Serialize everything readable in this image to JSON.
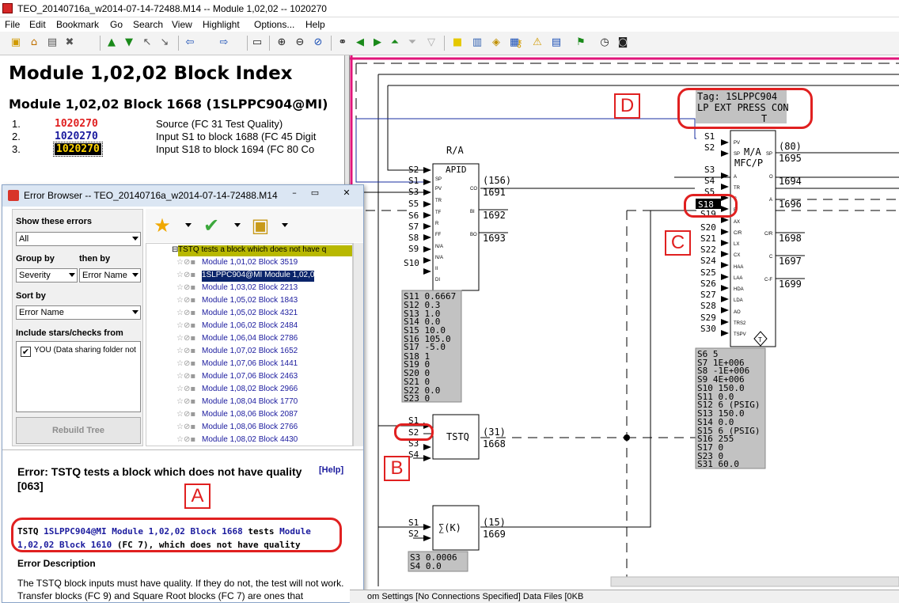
{
  "window": {
    "title": "TEO_20140716a_w2014-07-14-72488.M14 -- Module 1,02,02 -- 1020270"
  },
  "menu": [
    "File",
    "Edit",
    "Bookmark",
    "Go",
    "Search",
    "View",
    "Highlight",
    "Options...",
    "Help"
  ],
  "toolbar_icons": [
    "save-icon",
    "home-icon",
    "print-icon",
    "close-icon",
    "up-icon",
    "down-icon",
    "expand-icon",
    "collapse-icon",
    "back-icon",
    "forward-icon",
    "window-icon",
    "zoom-in-icon",
    "zoom-out-icon",
    "zoom-fit-icon",
    "binoculars-icon",
    "prev-icon",
    "next-icon",
    "find-prev-icon",
    "find-next-icon",
    "highlight-icon",
    "bookmark-icon",
    "tag-icon",
    "database-icon",
    "key-icon",
    "warning-icon",
    "list-icon",
    "flag-icon",
    "goto-icon",
    "clock-icon",
    "camera-icon"
  ],
  "index": {
    "title": "Module 1,02,02 Block Index",
    "block_title": "Module 1,02,02 Block 1668 (1SLPPC904@MI)",
    "rows": [
      {
        "num": "1.",
        "value": "1020270",
        "desc": "Source (FC 31 Test Quality)"
      },
      {
        "num": "2.",
        "value": "1020270",
        "desc": "Input S1 to block 1688 (FC 45 Digit"
      },
      {
        "num": "3.",
        "value": "1020270",
        "desc": "Input S18 to block 1694 (FC 80 Co"
      }
    ]
  },
  "error_browser": {
    "title": "Error Browser -- TEO_20140716a_w2014-07-14-72488.M14",
    "show_label": "Show these errors",
    "show_value": "All",
    "group_label": "Group by",
    "then_label": "then by",
    "group_value": "Severity",
    "then_value": "Error Name",
    "sort_label": "Sort by",
    "sort_value": "Error Name",
    "include_label": "Include stars/checks from",
    "include_item": "YOU (Data sharing folder not",
    "include_check": "✔",
    "rebuild_label": "Rebuild Tree",
    "toolbar_icons": [
      "star-icon",
      "checkmark-icon",
      "add-folder-icon"
    ],
    "tree_header": "TSTQ tests a block which does not have q",
    "tree_items": [
      "Module 1,01,02 Block 3519",
      "1SLPPC904@MI Module 1,02,0",
      "Module 1,03,02 Block 2213",
      "Module 1,05,02 Block 1843",
      "Module 1,05,02 Block 4321",
      "Module 1,06,02 Block 2484",
      "Module 1,06,04 Block 2786",
      "Module 1,07,02 Block 1652",
      "Module 1,07,06 Block 1441",
      "Module 1,07,06 Block 2463",
      "Module 1,08,02 Block 2966",
      "Module 1,08,04 Block 1770",
      "Module 1,08,06 Block 2087",
      "Module 1,08,06 Block 2766",
      "Module 1,08,02 Block 4430"
    ],
    "error_heading": "Error: TSTQ tests a block which does not have quality",
    "help": "[Help]",
    "error_code": "[063]",
    "msg_a": "TSTQ ",
    "msg_b": "1SLPPC904@MI Module 1,02,02 Block 1668",
    "msg_c": " tests ",
    "msg_d": "Module 1,02,02 Block 1610",
    "msg_e": " (FC 7), which does not have quality",
    "desc_head": "Error Description",
    "desc_text": "The TSTQ block inputs must have quality. If they do not, the test will not work. Transfer blocks (FC 9) and Square Root blocks (FC 7) are ones that"
  },
  "callout_labels": {
    "a": "A",
    "b": "B",
    "c": "C",
    "d": "D"
  },
  "diagram": {
    "ra_title": "R/A",
    "apid_name": "APID",
    "apid_inputs": [
      "S2",
      "S1",
      "S3",
      "S5",
      "S6",
      "S7",
      "S8",
      "S9",
      "S10"
    ],
    "apid_pins": [
      "SP",
      "PV",
      "TR",
      "TF",
      "R",
      "FF",
      "N/A",
      "N/A",
      "II",
      "DI"
    ],
    "apid_out_pins": [
      "CO",
      "BI",
      "BO"
    ],
    "apid_outputs": [
      {
        "n": "(156)",
        "b": "1691"
      },
      {
        "n": "",
        "b": "1692"
      },
      {
        "n": "",
        "b": "1693"
      }
    ],
    "apid_params": [
      "S11 0.6667",
      "S12 0.3",
      "S13 1.0",
      "S14 0.0",
      "S15 10.0",
      "S16 105.0",
      "S17 -5.0",
      "S18 1",
      "S19 0",
      "S20 0",
      "S21 0",
      "S22 0.0",
      "S23 0"
    ],
    "tstq_name": "TSTQ",
    "tstq_inputs": [
      "S1",
      "S2",
      "S3",
      "S4"
    ],
    "tstq_out": "(31)",
    "tstq_block": "1668",
    "sum_name": "∑(K)",
    "sum_inputs": [
      "S1",
      "S2"
    ],
    "sum_out": "(15)",
    "sum_block": "1669",
    "sum_params": [
      "S3  0.0006",
      "S4  0.0"
    ],
    "tag_line1": "Tag: 1SLPPC904",
    "tag_line2": "LP EXT PRESS CON",
    "tag_line3": "T",
    "mfc_name1": "M/A",
    "mfc_name2": "MFC/P",
    "mfc_inputs": [
      "S1",
      "S2",
      "S3",
      "S4",
      "S5",
      "S18",
      "S19",
      "S20",
      "S21",
      "S22",
      "S24",
      "S25",
      "S26",
      "S27",
      "S28",
      "S29",
      "S30"
    ],
    "mfc_in_pins": [
      "PV",
      "SP",
      "A",
      "TR",
      "S",
      "E",
      "AX",
      "C/R",
      "LX",
      "CX",
      "HAA",
      "LAA",
      "HDA",
      "LDA",
      "AO",
      "TRS2",
      "TSPV"
    ],
    "mfc_out_pins": [
      "SP",
      "O",
      "A",
      "C/R",
      "C",
      "C-F"
    ],
    "mfc_outputs": [
      {
        "n": "(80)",
        "b": "1695"
      },
      {
        "n": "",
        "b": "1694"
      },
      {
        "n": "",
        "b": "1696"
      },
      {
        "n": "",
        "b": "1698"
      },
      {
        "n": "",
        "b": "1697"
      },
      {
        "n": "",
        "b": "1699"
      }
    ],
    "mfc_params": [
      "S6  5",
      "S7  1E+006",
      "S8  -1E+006",
      "S9  4E+006",
      "S10 150.0",
      "S11 0.0",
      "S12 6 (PSIG)",
      "S13 150.0",
      "S14 0.0",
      "S15 6 (PSIG)",
      "S16 255",
      "S17 0",
      "S23 0",
      "S31 60.0"
    ]
  },
  "status": {
    "text": "om Settings [No Connections Specified] Data Files [0KB"
  }
}
